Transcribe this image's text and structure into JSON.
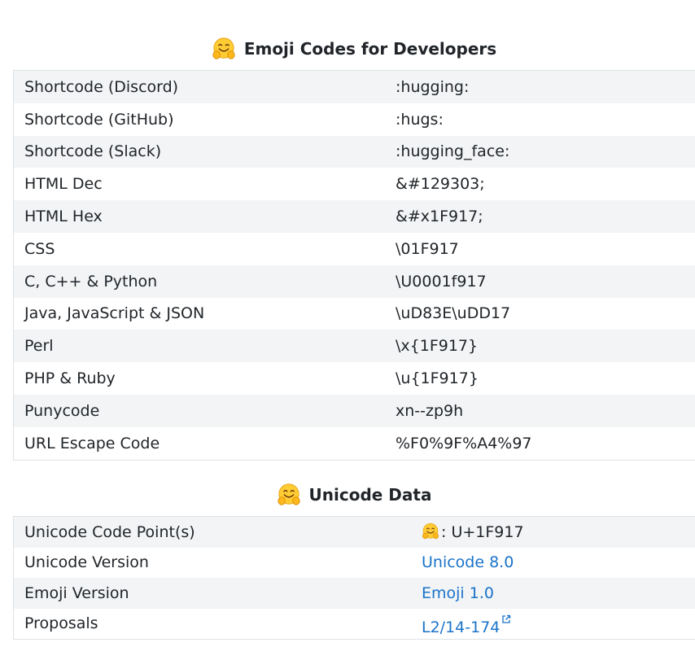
{
  "developer_codes": {
    "title": "Emoji Codes for Developers",
    "rows": [
      {
        "label": "Shortcode (Discord)",
        "value": ":hugging:"
      },
      {
        "label": "Shortcode (GitHub)",
        "value": ":hugs:"
      },
      {
        "label": "Shortcode (Slack)",
        "value": ":hugging_face:"
      },
      {
        "label": "HTML Dec",
        "value": "&#129303;"
      },
      {
        "label": "HTML Hex",
        "value": "&#x1F917;"
      },
      {
        "label": "CSS",
        "value": "\\01F917"
      },
      {
        "label": "C, C++ & Python",
        "value": "\\U0001f917"
      },
      {
        "label": "Java, JavaScript & JSON",
        "value": "\\uD83E\\uDD17"
      },
      {
        "label": "Perl",
        "value": "\\x{1F917}"
      },
      {
        "label": "PHP & Ruby",
        "value": "\\u{1F917}"
      },
      {
        "label": "Punycode",
        "value": "xn--zp9h"
      },
      {
        "label": "URL Escape Code",
        "value": "%F0%9F%A4%97"
      }
    ]
  },
  "unicode_data": {
    "title": "Unicode Data",
    "code_point_label": "Unicode Code Point(s)",
    "code_point_value": ": U+1F917",
    "version_label": "Unicode Version",
    "version_value": "Unicode 8.0",
    "emoji_version_label": "Emoji Version",
    "emoji_version_value": "Emoji 1.0",
    "proposals_label": "Proposals",
    "proposals_value": "L2/14-174"
  },
  "icons": {
    "emoji": "hugging-face-emoji-icon",
    "external": "external-link-icon"
  },
  "colors": {
    "link": "#1a73c8",
    "stripe": "#f2f4f6"
  }
}
